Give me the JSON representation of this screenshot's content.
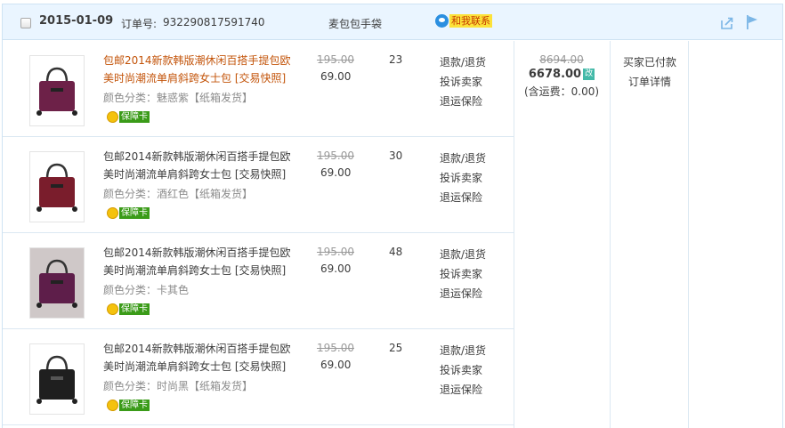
{
  "header": {
    "date": "2015-01-09",
    "order_label": "订单号:",
    "order_no": "932290817591740",
    "shop": "麦包包手袋",
    "contact": "和我联系"
  },
  "colors": {
    "thumb": [
      "#6d2148",
      "#7a1d2c",
      "#5e1e4a",
      "#1f1f1f"
    ]
  },
  "items": [
    {
      "title": "包邮2014新款韩版潮休闲百搭手提包欧美时尚潮流单肩斜跨女士包",
      "tag": "[交易快照]",
      "attr": "颜色分类：魅惑紫【纸箱发货】",
      "card": "保障卡",
      "orig": "195.00",
      "price": "69.00",
      "qty": "23",
      "ops": [
        "退款/退货",
        "投诉卖家",
        "退运保险"
      ]
    },
    {
      "title": "包邮2014新款韩版潮休闲百搭手提包欧美时尚潮流单肩斜跨女士包",
      "tag": "[交易快照]",
      "attr": "颜色分类：酒红色【纸箱发货】",
      "card": "保障卡",
      "orig": "195.00",
      "price": "69.00",
      "qty": "30",
      "ops": [
        "退款/退货",
        "投诉卖家",
        "退运保险"
      ]
    },
    {
      "title": "包邮2014新款韩版潮休闲百搭手提包欧美时尚潮流单肩斜跨女士包",
      "tag": "[交易快照]",
      "attr": "颜色分类：卡其色",
      "card": "保障卡",
      "orig": "195.00",
      "price": "69.00",
      "qty": "48",
      "ops": [
        "退款/退货",
        "投诉卖家",
        "退运保险"
      ]
    },
    {
      "title": "包邮2014新款韩版潮休闲百搭手提包欧美时尚潮流单肩斜跨女士包",
      "tag": "[交易快照]",
      "attr": "颜色分类：时尚黑【纸箱发货】",
      "card": "保障卡",
      "orig": "195.00",
      "price": "69.00",
      "qty": "25",
      "ops": [
        "退款/退货",
        "投诉卖家",
        "退运保险"
      ]
    }
  ],
  "payment": {
    "orig_total": "8694.00",
    "total": "6678.00",
    "badge": "改",
    "shipping": "(含运费：0.00)"
  },
  "status": {
    "state": "买家已付款",
    "detail": "订单详情"
  }
}
